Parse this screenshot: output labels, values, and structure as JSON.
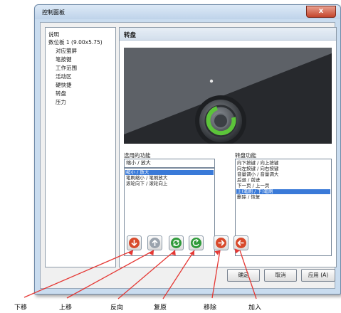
{
  "window": {
    "title": "控制面板",
    "close_glyph": "x"
  },
  "tree": {
    "items": [
      {
        "label": "说明",
        "level": 0
      },
      {
        "label": "数位板 1 (9.00x5.75)",
        "level": 0
      },
      {
        "label": "对应萤屏",
        "level": 1
      },
      {
        "label": "笔按键",
        "level": 1
      },
      {
        "label": "工作范围",
        "level": 1
      },
      {
        "label": "活动区",
        "level": 1
      },
      {
        "label": "硬快捷",
        "level": 1
      },
      {
        "label": "转盘",
        "level": 1
      },
      {
        "label": "压力",
        "level": 1
      }
    ]
  },
  "panel": {
    "title": "转盘"
  },
  "selected_functions": {
    "label": "选用的功能",
    "value": "缩小 / 放大",
    "items": [
      "缩小 / 放大",
      "笔刷缩小 / 笔刷放大",
      "滚轮向下 / 滚轮向上"
    ],
    "selected_index": 0
  },
  "dial_functions": {
    "label": "转盘功能",
    "items": [
      "向下按键 / 向上按键",
      "向左按键 / 向右按键",
      "音量调小 / 音量调大",
      "后退 / 前进",
      "下一页 / 上一页",
      "上(笔刷 / 下)笔刷",
      "删除 / 恢复"
    ],
    "selected_index": 5
  },
  "action_buttons": [
    {
      "name": "move-down",
      "caption": "下移",
      "color": "#d84a2c",
      "icon": "arrow-down-icon"
    },
    {
      "name": "move-up",
      "caption": "上移",
      "color": "#9aa3ad",
      "icon": "arrow-up-icon"
    },
    {
      "name": "reverse",
      "caption": "反向",
      "color": "#2f9a3a",
      "icon": "reverse-icon"
    },
    {
      "name": "restore",
      "caption": "复原",
      "color": "#2f9a3a",
      "icon": "restore-icon"
    },
    {
      "name": "remove",
      "caption": "移除",
      "color": "#d84a2c",
      "icon": "arrow-right-icon"
    },
    {
      "name": "add",
      "caption": "加入",
      "color": "#d84a2c",
      "icon": "arrow-left-icon"
    }
  ],
  "dialog_buttons": {
    "ok": "确定",
    "cancel": "取消",
    "apply": "应用 (A)"
  },
  "colors": {
    "arrow": "#e53935",
    "accent_green": "#5cc43a",
    "selection": "#3a7ad8"
  }
}
